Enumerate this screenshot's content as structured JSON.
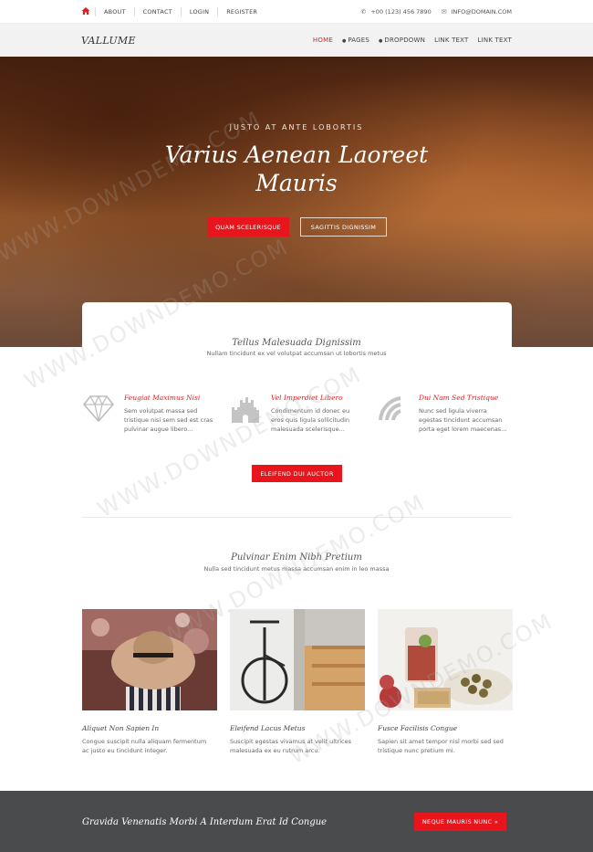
{
  "topbar": {
    "links": [
      "ABOUT",
      "CONTACT",
      "LOGIN",
      "REGISTER"
    ],
    "phone": "+00 (123) 456 7890",
    "email": "INFO@DOMAIN.COM"
  },
  "nav": {
    "logo": "VALLUME",
    "items": [
      "HOME",
      "PAGES",
      "DROPDOWN",
      "LINK TEXT",
      "LINK TEXT"
    ]
  },
  "hero": {
    "kicker": "JUSTO AT ANTE LOBORTIS",
    "title_line1": "Varius Aenean Laoreet",
    "title_line2": "Mauris",
    "primary_button": "QUAM SCELERISQUE",
    "secondary_button": "SAGITTIS DIGNISSIM"
  },
  "features": {
    "title": "Tellus Malesuada Dignissim",
    "subtitle": "Nullam tincidunt ex vel volutpat accumsan ut lobortis metus",
    "items": [
      {
        "title": "Feugiat Maximus Nisi",
        "line1": "Sem volutpat massa sed",
        "line2": "tristique nisi sem sed est cras",
        "line3": "pulvinar augue libero...",
        "icon": "diamond-icon"
      },
      {
        "title": "Vel Imperdiet Libero",
        "line1": "Condimentum id donec eu",
        "line2": "eros quis ligula sollicitudin",
        "line3": "malesuada scelerisque...",
        "icon": "castle-icon"
      },
      {
        "title": "Dui Nam Sed Tristique",
        "line1": "Nunc sed ligula viverra",
        "line2": "egestas tincidunt accumsan",
        "line3": "porta eget lorem maecenas...",
        "icon": "signal-icon"
      }
    ],
    "button": "ELEIFEND DUI AUCTOR"
  },
  "portfolio": {
    "title": "Pulvinar Enim Nibh Pretium",
    "subtitle": "Nulla sed tincidunt metus massa accumsan enim in leo massa",
    "items": [
      {
        "title": "Aliquet Non Sapien In",
        "line1": "Congue suscipit nulla aliquam fermentum",
        "line2": "ac justo eu tincidunt integer."
      },
      {
        "title": "Eleifend Lacus Metus",
        "line1": "Suscipit egestas vivamus at velit ultrices",
        "line2": "malesuada ex eu rutrum arcu."
      },
      {
        "title": "Fusce Facilisis Congue",
        "line1": "Sapien sit amet tempor nisl morbi sed sed",
        "line2": "tristique nunc pretium mi."
      }
    ]
  },
  "cta": {
    "text": "Gravida Venenatis Morbi A Interdum Erat Id Congue",
    "button": "NEQUE MAURIS NUNC »"
  },
  "watermark": "WWW.DOWNDEMO.COM",
  "colors": {
    "accent": "#e8151c",
    "nav_bg": "#f2f2f2",
    "footer_bg": "#4a4b4d"
  }
}
